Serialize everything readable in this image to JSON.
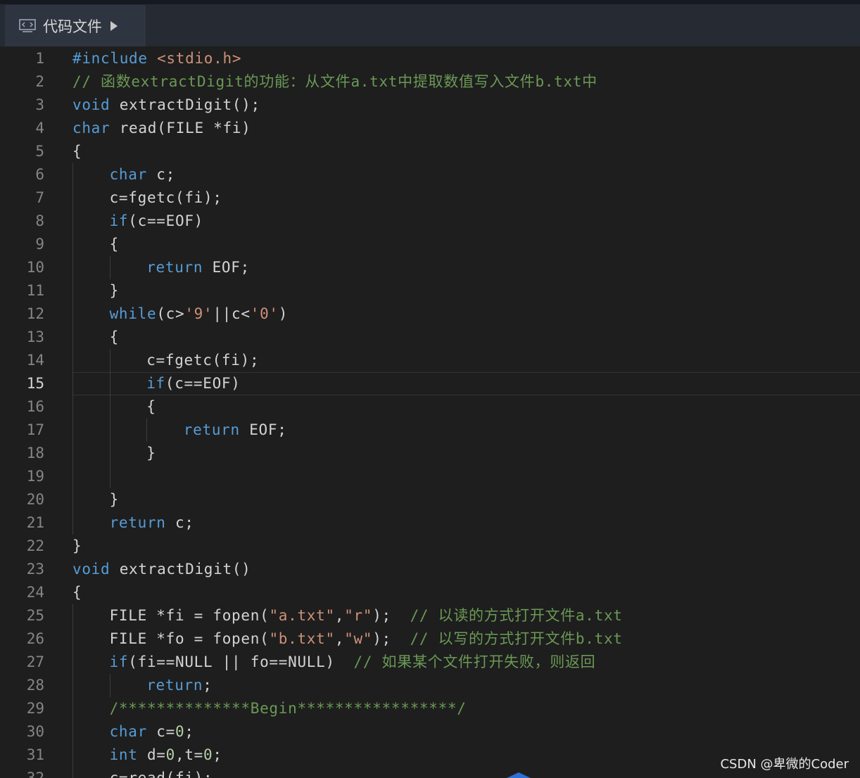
{
  "tab": {
    "label": "代码文件"
  },
  "active_line": 15,
  "watermark": "CSDN @卑微的Coder",
  "colors": {
    "keyword": "#569cd6",
    "string": "#ce9178",
    "comment": "#6a9955",
    "number": "#b5cea8",
    "text": "#d4d4d4"
  },
  "lines": [
    {
      "n": "1",
      "indent": 0,
      "tokens": [
        [
          "kw",
          "#include"
        ],
        [
          "tx",
          " "
        ],
        [
          "st",
          "<stdio.h>"
        ]
      ]
    },
    {
      "n": "2",
      "indent": 0,
      "tokens": [
        [
          "cm",
          "// 函数extractDigit的功能：从文件a.txt中提取数值写入文件b.txt中"
        ]
      ]
    },
    {
      "n": "3",
      "indent": 0,
      "tokens": [
        [
          "kw",
          "void"
        ],
        [
          "tx",
          " extractDigit();"
        ]
      ]
    },
    {
      "n": "4",
      "indent": 0,
      "tokens": [
        [
          "kw",
          "char"
        ],
        [
          "tx",
          " read(FILE *fi)"
        ]
      ]
    },
    {
      "n": "5",
      "indent": 0,
      "tokens": [
        [
          "tx",
          "{"
        ]
      ]
    },
    {
      "n": "6",
      "indent": 1,
      "tokens": [
        [
          "kw",
          "char"
        ],
        [
          "tx",
          " c;"
        ]
      ]
    },
    {
      "n": "7",
      "indent": 1,
      "tokens": [
        [
          "tx",
          "c=fgetc(fi);"
        ]
      ]
    },
    {
      "n": "8",
      "indent": 1,
      "tokens": [
        [
          "kw",
          "if"
        ],
        [
          "tx",
          "(c==EOF)"
        ]
      ]
    },
    {
      "n": "9",
      "indent": 1,
      "tokens": [
        [
          "tx",
          "{"
        ]
      ]
    },
    {
      "n": "10",
      "indent": 2,
      "tokens": [
        [
          "kw",
          "return"
        ],
        [
          "tx",
          " EOF;"
        ]
      ]
    },
    {
      "n": "11",
      "indent": 1,
      "tokens": [
        [
          "tx",
          "}"
        ]
      ]
    },
    {
      "n": "12",
      "indent": 1,
      "tokens": [
        [
          "kw",
          "while"
        ],
        [
          "tx",
          "(c>"
        ],
        [
          "st",
          "'9'"
        ],
        [
          "tx",
          "||c<"
        ],
        [
          "st",
          "'0'"
        ],
        [
          "tx",
          ")"
        ]
      ]
    },
    {
      "n": "13",
      "indent": 1,
      "tokens": [
        [
          "tx",
          "{"
        ]
      ]
    },
    {
      "n": "14",
      "indent": 2,
      "tokens": [
        [
          "tx",
          "c=fgetc(fi);"
        ]
      ]
    },
    {
      "n": "15",
      "indent": 2,
      "tokens": [
        [
          "kw",
          "if"
        ],
        [
          "tx",
          "(c==EOF)"
        ]
      ]
    },
    {
      "n": "16",
      "indent": 2,
      "tokens": [
        [
          "tx",
          "{"
        ]
      ]
    },
    {
      "n": "17",
      "indent": 3,
      "tokens": [
        [
          "kw",
          "return"
        ],
        [
          "tx",
          " EOF;"
        ]
      ]
    },
    {
      "n": "18",
      "indent": 2,
      "tokens": [
        [
          "tx",
          "}"
        ]
      ]
    },
    {
      "n": "19",
      "indent": 0,
      "tokens": []
    },
    {
      "n": "20",
      "indent": 1,
      "tokens": [
        [
          "tx",
          "}"
        ]
      ]
    },
    {
      "n": "21",
      "indent": 1,
      "tokens": [
        [
          "kw",
          "return"
        ],
        [
          "tx",
          " c;"
        ]
      ]
    },
    {
      "n": "22",
      "indent": 0,
      "tokens": [
        [
          "tx",
          "}"
        ]
      ]
    },
    {
      "n": "23",
      "indent": 0,
      "tokens": [
        [
          "kw",
          "void"
        ],
        [
          "tx",
          " extractDigit()"
        ]
      ]
    },
    {
      "n": "24",
      "indent": 0,
      "tokens": [
        [
          "tx",
          "{"
        ]
      ]
    },
    {
      "n": "25",
      "indent": 1,
      "tokens": [
        [
          "tx",
          "FILE *fi = fopen("
        ],
        [
          "st",
          "\"a.txt\""
        ],
        [
          "tx",
          ","
        ],
        [
          "st",
          "\"r\""
        ],
        [
          "tx",
          ");  "
        ],
        [
          "cm",
          "// 以读的方式打开文件a.txt"
        ]
      ]
    },
    {
      "n": "26",
      "indent": 1,
      "tokens": [
        [
          "tx",
          "FILE *fo = fopen("
        ],
        [
          "st",
          "\"b.txt\""
        ],
        [
          "tx",
          ","
        ],
        [
          "st",
          "\"w\""
        ],
        [
          "tx",
          ");  "
        ],
        [
          "cm",
          "// 以写的方式打开文件b.txt"
        ]
      ]
    },
    {
      "n": "27",
      "indent": 1,
      "tokens": [
        [
          "kw",
          "if"
        ],
        [
          "tx",
          "(fi==NULL || fo==NULL)  "
        ],
        [
          "cm",
          "// 如果某个文件打开失败，则返回"
        ]
      ]
    },
    {
      "n": "28",
      "indent": 2,
      "tokens": [
        [
          "kw",
          "return"
        ],
        [
          "tx",
          ";"
        ]
      ]
    },
    {
      "n": "29",
      "indent": 1,
      "tokens": [
        [
          "cm",
          "/**************Begin*****************/"
        ]
      ]
    },
    {
      "n": "30",
      "indent": 1,
      "tokens": [
        [
          "kw",
          "char"
        ],
        [
          "tx",
          " c="
        ],
        [
          "nm",
          "0"
        ],
        [
          "tx",
          ";"
        ]
      ]
    },
    {
      "n": "31",
      "indent": 1,
      "tokens": [
        [
          "kw",
          "int"
        ],
        [
          "tx",
          " d="
        ],
        [
          "nm",
          "0"
        ],
        [
          "tx",
          ",t="
        ],
        [
          "nm",
          "0"
        ],
        [
          "tx",
          ";"
        ]
      ]
    },
    {
      "n": "32",
      "indent": 1,
      "tokens": [
        [
          "tx",
          "c=read(fi);"
        ]
      ]
    }
  ]
}
